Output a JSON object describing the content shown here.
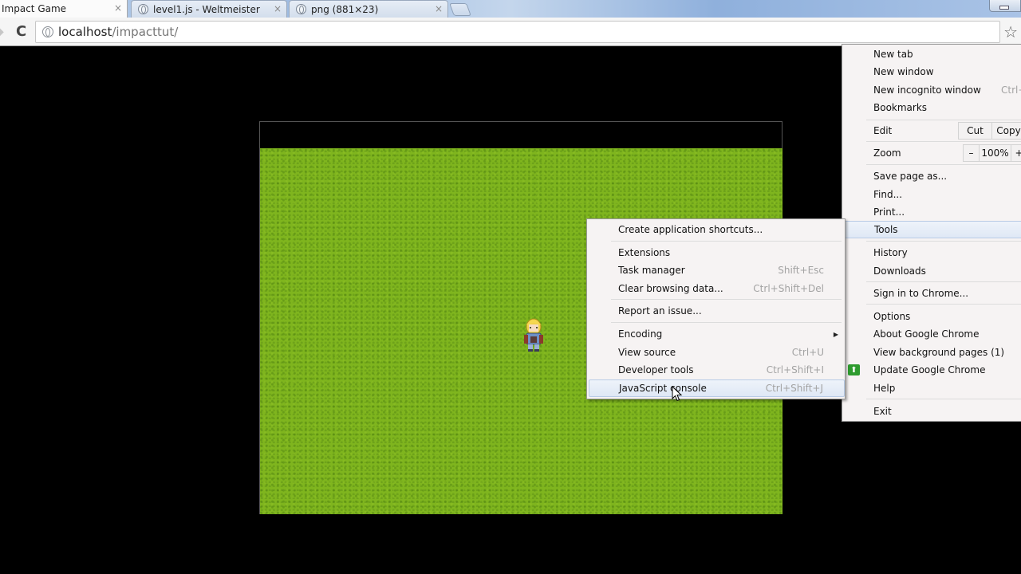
{
  "browser": {
    "tabs": [
      {
        "title": "Impact Game",
        "active": true,
        "close": "×"
      },
      {
        "title": "level1.js - Weltmeister",
        "active": false,
        "close": "×"
      },
      {
        "title": "png (881×23)",
        "active": false,
        "close": "×"
      }
    ],
    "address_bar": {
      "host": "localhost",
      "path": "/impacttut/"
    },
    "icons": {
      "back": "◆",
      "reload": "C",
      "star": "☆"
    }
  },
  "game": {
    "title": "Impact Game",
    "colors": {
      "grass": "#7fb51e",
      "frame": "#000000"
    }
  },
  "main_menu": {
    "items": [
      {
        "label": "New tab"
      },
      {
        "label": "New window"
      },
      {
        "label": "New incognito window",
        "shortcut": "Ctrl+"
      },
      {
        "label": "Bookmarks"
      },
      {
        "label": "Edit",
        "buttons": [
          "Cut",
          "Copy"
        ]
      },
      {
        "label": "Zoom",
        "buttons": [
          "–",
          "100%",
          "+"
        ]
      },
      {
        "label": "Save page as..."
      },
      {
        "label": "Find..."
      },
      {
        "label": "Print..."
      },
      {
        "label": "Tools",
        "highlighted": true
      },
      {
        "label": "History"
      },
      {
        "label": "Downloads"
      },
      {
        "label": "Sign in to Chrome..."
      },
      {
        "label": "Options"
      },
      {
        "label": "About Google Chrome"
      },
      {
        "label": "View background pages (1)"
      },
      {
        "label": "Update Google Chrome",
        "icon": "update-arrow"
      },
      {
        "label": "Help"
      },
      {
        "label": "Exit"
      }
    ]
  },
  "tools_menu": {
    "items": [
      {
        "label": "Create application shortcuts..."
      },
      {
        "label": "Extensions"
      },
      {
        "label": "Task manager",
        "shortcut": "Shift+Esc"
      },
      {
        "label": "Clear browsing data...",
        "shortcut": "Ctrl+Shift+Del"
      },
      {
        "label": "Report an issue..."
      },
      {
        "label": "Encoding",
        "submenu": true
      },
      {
        "label": "View source",
        "shortcut": "Ctrl+U"
      },
      {
        "label": "Developer tools",
        "shortcut": "Ctrl+Shift+I"
      },
      {
        "label": "JavaScript console",
        "shortcut": "Ctrl+Shift+J",
        "highlighted": true
      }
    ]
  },
  "update_icon_glyph": "⬆",
  "submenu_arrow_glyph": "▶"
}
